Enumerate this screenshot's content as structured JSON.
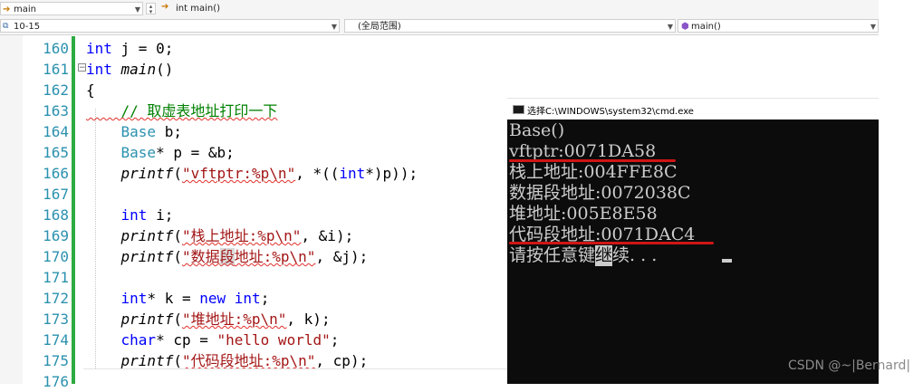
{
  "navbar": {
    "scope_label": "main",
    "function_label": "int main()",
    "lines_label": "10-15",
    "global_scope_label": "(全局范围)",
    "member_label": "main()"
  },
  "editor": {
    "line_numbers": [
      "160",
      "161",
      "162",
      "163",
      "164",
      "165",
      "166",
      "167",
      "168",
      "169",
      "170",
      "171",
      "172",
      "173",
      "174",
      "175",
      "176"
    ],
    "lines": {
      "l160_kw": "int",
      "l160_rest": " j = 0;",
      "l161_kw": "int",
      "l161_fn": " main",
      "l161_rest": "()",
      "l162": "{",
      "l163": "    // 取虚表地址打印一下",
      "l164_ty": "    Base",
      "l164_rest": " b;",
      "l165_ty": "    Base",
      "l165_rest": "* p = &b;",
      "l166_fn": "    printf",
      "l166_a": "(",
      "l166_str": "\"vftptr:%p\\n\"",
      "l166_b": ", *((",
      "l166_kw": "int",
      "l166_c": "*)p));",
      "l168_kw": "    int",
      "l168_rest": " i;",
      "l169_fn": "    printf",
      "l169_a": "(",
      "l169_str": "\"栈上地址:%p\\n\"",
      "l169_b": ", &i);",
      "l170_fn": "    printf",
      "l170_a": "(",
      "l170_str1": "\"数据",
      "l170_hl": "段",
      "l170_str2": "地址:%p\\n\"",
      "l170_b": ", &j);",
      "l172_kw": "    int",
      "l172_a": "* k = ",
      "l172_kw2": "new",
      "l172_b": " ",
      "l172_kw3": "int",
      "l172_c": ";",
      "l173_fn": "    printf",
      "l173_a": "(",
      "l173_str": "\"堆地址:%p\\n\"",
      "l173_b": ", k);",
      "l174_kw": "    char",
      "l174_a": "* cp = ",
      "l174_str": "\"hello world\"",
      "l174_b": ";",
      "l175_fn": "    printf",
      "l175_a": "(",
      "l175_str": "\"代码段地址:%p\\n\"",
      "l175_b": ", cp);"
    }
  },
  "console": {
    "title": "选择C:\\WINDOWS\\system32\\cmd.exe",
    "lines": [
      "Base()",
      "vftptr:0071DA58",
      "栈上地址:004FFE8C",
      "数据段地址:0072038C",
      "堆地址:005E8E58",
      "代码段地址:0071DAC4"
    ],
    "prompt_pre": "请按任意键",
    "prompt_cursor": "继",
    "prompt_post": "续. . . "
  },
  "watermark": "CSDN @~|Bernard|",
  "colors": {
    "keyword": "#0000ff",
    "type": "#2b91af",
    "comment": "#008000",
    "string": "#a31515",
    "console_bg": "#0c0c0c",
    "annotation": "#d01515"
  }
}
